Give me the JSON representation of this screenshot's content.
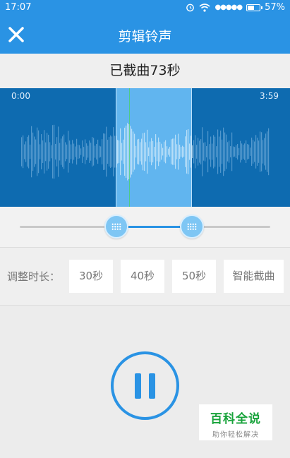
{
  "status_bar": {
    "time": "17:07",
    "signal": "●●●●●",
    "battery_text": "57%",
    "battery_level": 0.57
  },
  "app_bar": {
    "title": "剪辑铃声",
    "close_icon": "close-icon"
  },
  "clip_info": "已截曲73秒",
  "waveform": {
    "start_time": "0:00",
    "end_time": "3:59"
  },
  "duration": {
    "label": "调整时长：",
    "buttons": [
      "30秒",
      "40秒",
      "50秒",
      "智能截曲"
    ]
  },
  "player": {
    "state": "playing",
    "icon": "pause-icon"
  },
  "watermark": {
    "title": "百科全说",
    "subtitle": "助你轻松解决"
  },
  "colors": {
    "accent": "#2a93e4",
    "waveform_bg": "#0e6bb0",
    "selection": "#61b5ef",
    "watermark": "#18a33b"
  }
}
